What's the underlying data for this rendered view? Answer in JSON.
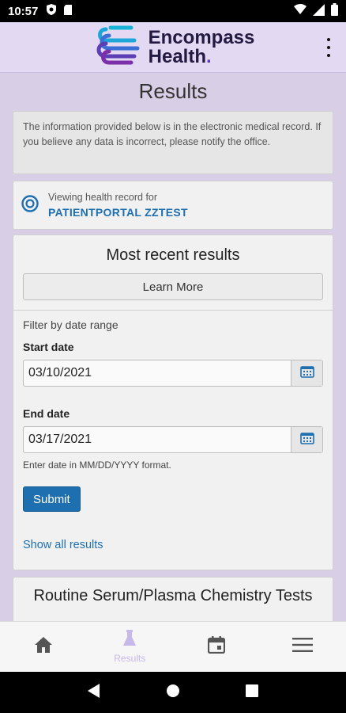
{
  "status_bar": {
    "time": "10:57"
  },
  "header": {
    "logo_text_line1": "Encompass",
    "logo_text_line2": "Health",
    "brand_color": "#5c3fb5"
  },
  "page": {
    "title": "Results"
  },
  "notice": {
    "text": "The information provided below is in the electronic medical record. If you believe any data is incorrect, please notify the office."
  },
  "viewing": {
    "label": "Viewing health record for",
    "patient": "PATIENTPORTAL ZZTEST"
  },
  "recent_results": {
    "title": "Most recent results",
    "learn_more": "Learn More",
    "filter_label": "Filter by date range",
    "start_label": "Start date",
    "start_value": "03/10/2021",
    "end_label": "End date",
    "end_value": "03/17/2021",
    "hint": "Enter date in MM/DD/YYYY format.",
    "submit": "Submit",
    "show_all": "Show all results"
  },
  "next_card": {
    "title": "Routine Serum/Plasma Chemistry Tests"
  },
  "bottom_nav": {
    "items": [
      {
        "icon": "home-icon",
        "label": ""
      },
      {
        "icon": "flask-icon",
        "label": "Results"
      },
      {
        "icon": "calendar-icon",
        "label": ""
      },
      {
        "icon": "menu-icon",
        "label": ""
      }
    ]
  },
  "colors": {
    "accent_blue": "#1d6fb0",
    "background": "#d8cfe6",
    "nav_active": "#c7b8ea"
  }
}
